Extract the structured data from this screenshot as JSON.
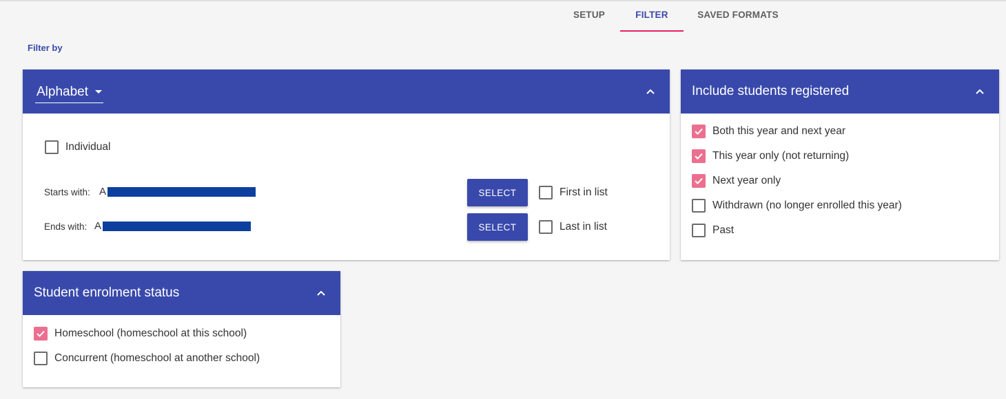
{
  "tabs": [
    "SETUP",
    "FILTER",
    "SAVED FORMATS"
  ],
  "filter_by_label": "Filter by",
  "alphabet_card": {
    "dropdown_value": "Alphabet",
    "individual_label": "Individual",
    "individual_checked": false,
    "starts_with_label": "Starts with:",
    "starts_with_value": "A",
    "ends_with_label": "Ends with:",
    "ends_with_value": "A",
    "select_label": "SELECT",
    "first_in_list_label": "First in list",
    "last_in_list_label": "Last in list"
  },
  "registered_card": {
    "title": "Include students registered",
    "options": [
      {
        "label": "Both this year and next year",
        "checked": true
      },
      {
        "label": "This year only (not returning)",
        "checked": true
      },
      {
        "label": "Next year only",
        "checked": true
      },
      {
        "label": "Withdrawn (no longer enrolled this year)",
        "checked": false
      },
      {
        "label": "Past",
        "checked": false
      }
    ]
  },
  "enrolment_card": {
    "title": "Student enrolment status",
    "options": [
      {
        "label": "Homeschool (homeschool at this school)",
        "checked": true
      },
      {
        "label": "Concurrent (homeschool at another school)",
        "checked": false
      }
    ]
  },
  "colors": {
    "primary": "#3949ab",
    "accent": "#e91e63",
    "checked": "#ec6f90",
    "redaction": "#0d3f9f"
  }
}
